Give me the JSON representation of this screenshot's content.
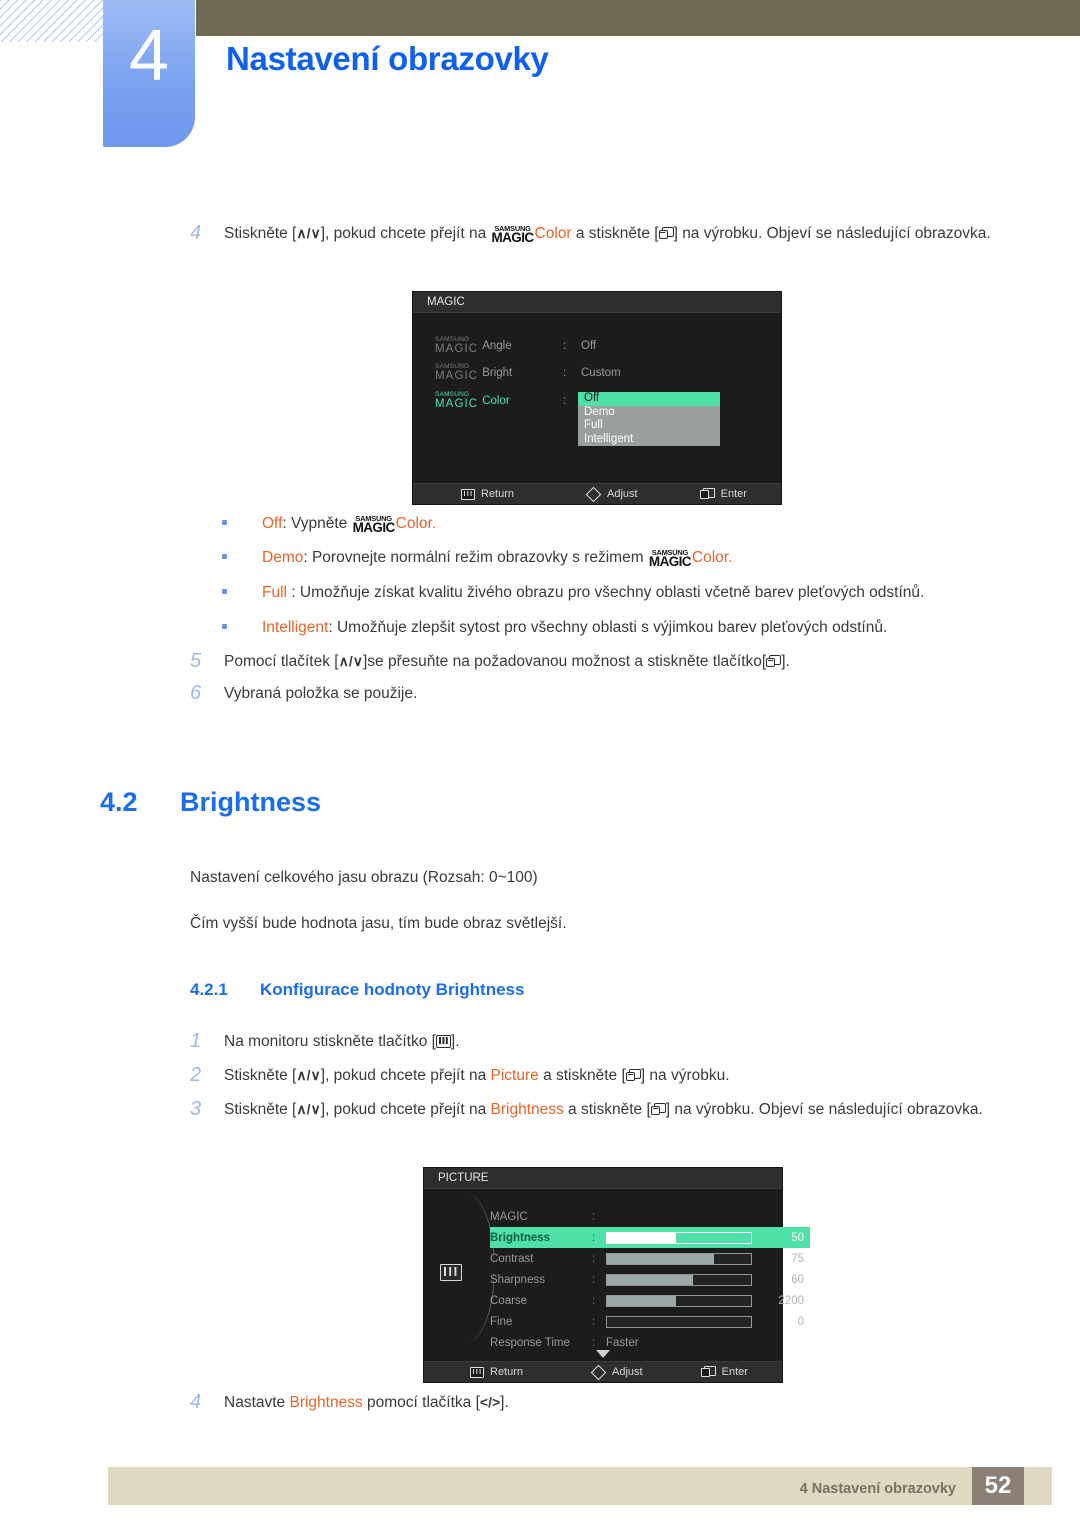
{
  "header": {
    "chapter_number": "4",
    "chapter_title": "Nastavení obrazovky",
    "accent_color": "#1060f0",
    "bar_color": "#6f6b53"
  },
  "step4": {
    "num": "4",
    "p1": "Stiskněte [",
    "p2": "], pokud chcete přejít na ",
    "magic_sam": "SAMSUNG",
    "magic_mag": "MAGIC",
    "color_word": "Color",
    "p3": " a stiskněte [",
    "p4": "] na výrobku. Objeví se následující obrazovka."
  },
  "osd_magic": {
    "title": "MAGIC",
    "rows": [
      {
        "sam": "SAMSUNG",
        "mag": "MAGIC",
        "name": "Angle",
        "value": "Off"
      },
      {
        "sam": "SAMSUNG",
        "mag": "MAGIC",
        "name": "Bright",
        "value": "Custom"
      },
      {
        "sam": "SAMSUNG",
        "mag": "MAGIC",
        "name": "Color",
        "value": ""
      }
    ],
    "dropdown": [
      "Off",
      "Demo",
      "Full",
      "Intelligent"
    ],
    "dropdown_selected": "Off",
    "highlight_color": "#4fe0a8",
    "footer": {
      "return": "Return",
      "adjust": "Adjust",
      "enter": "Enter"
    }
  },
  "bullets": [
    {
      "term": "Off",
      "sep": ": Vypněte ",
      "sam": "SAMSUNG",
      "mag": "MAGIC",
      "color_word": "Color",
      "tail": ".",
      "magic_first": false
    },
    {
      "term": "Demo",
      "sep": ": Porovnejte normální režim obrazovky s režimem ",
      "sam": "SAMSUNG",
      "mag": "MAGIC",
      "color_word": "Color",
      "tail": ".",
      "magic_first": false
    },
    {
      "term": "Full",
      "sep": " : Umožňuje získat kvalitu živého obrazu pro všechny oblasti včetně barev pleťových odstínů.",
      "plain": true
    },
    {
      "term": "Intelligent",
      "sep": ": Umožňuje zlepšit sytost pro všechny oblasti s výjimkou barev pleťových odstínů.",
      "plain": true
    }
  ],
  "step5": {
    "num": "5",
    "p1": "Pomocí tlačítek [",
    "p2": "]se přesuňte na požadovanou možnost a stiskněte tlačítko[",
    "p3": "]."
  },
  "step6": {
    "num": "6",
    "text": "Vybraná položka se použije."
  },
  "section": {
    "number": "4.2",
    "title": "Brightness",
    "para1": "Nastavení celkového jasu obrazu (Rozsah: 0~100)",
    "para2": "Čím vyšší bude hodnota jasu, tím bude obraz světlejší."
  },
  "subsection": {
    "number": "4.2.1",
    "title": "Konfigurace hodnoty Brightness"
  },
  "steps_421": [
    {
      "num": "1",
      "p1": "Na monitoru stiskněte tlačítko [",
      "p2": "]."
    },
    {
      "num": "2",
      "p1": "Stiskněte [",
      "p2": "], pokud chcete přejít na ",
      "hl": "Picture",
      "p3": " a stiskněte [",
      "p4": "] na výrobku."
    },
    {
      "num": "3",
      "p1": "Stiskněte [",
      "p2": "], pokud chcete přejít na ",
      "hl": "Brightness",
      "p3": " a stiskněte [",
      "p4": "] na výrobku. Objeví se následující obrazovka."
    }
  ],
  "osd_picture": {
    "title": "PICTURE",
    "rows": [
      {
        "name": "MAGIC",
        "type": "text",
        "value": "",
        "highlight": false
      },
      {
        "name": "Brightness",
        "type": "slider",
        "value": "50",
        "fill": 48,
        "highlight": true
      },
      {
        "name": "Contrast",
        "type": "slider",
        "value": "75",
        "fill": 74,
        "highlight": false
      },
      {
        "name": "Sharpness",
        "type": "slider",
        "value": "60",
        "fill": 60,
        "highlight": false
      },
      {
        "name": "Coarse",
        "type": "slider",
        "value": "2200",
        "fill": 48,
        "highlight": false
      },
      {
        "name": "Fine",
        "type": "slider",
        "value": "0",
        "fill": 0,
        "highlight": false
      },
      {
        "name": "Response Time",
        "type": "text",
        "value": "Faster",
        "highlight": false
      }
    ],
    "highlight_color": "#4fe0a8",
    "footer": {
      "return": "Return",
      "adjust": "Adjust",
      "enter": "Enter"
    }
  },
  "step4b": {
    "num": "4",
    "p1": "Nastavte ",
    "hl": "Brightness",
    "p2": " pomocí tlačítka [",
    "p3": "]."
  },
  "footer": {
    "text": "4 Nastavení obrazovky",
    "page": "52",
    "bar_color": "#dfd9c4",
    "page_color": "#8d7f74"
  }
}
